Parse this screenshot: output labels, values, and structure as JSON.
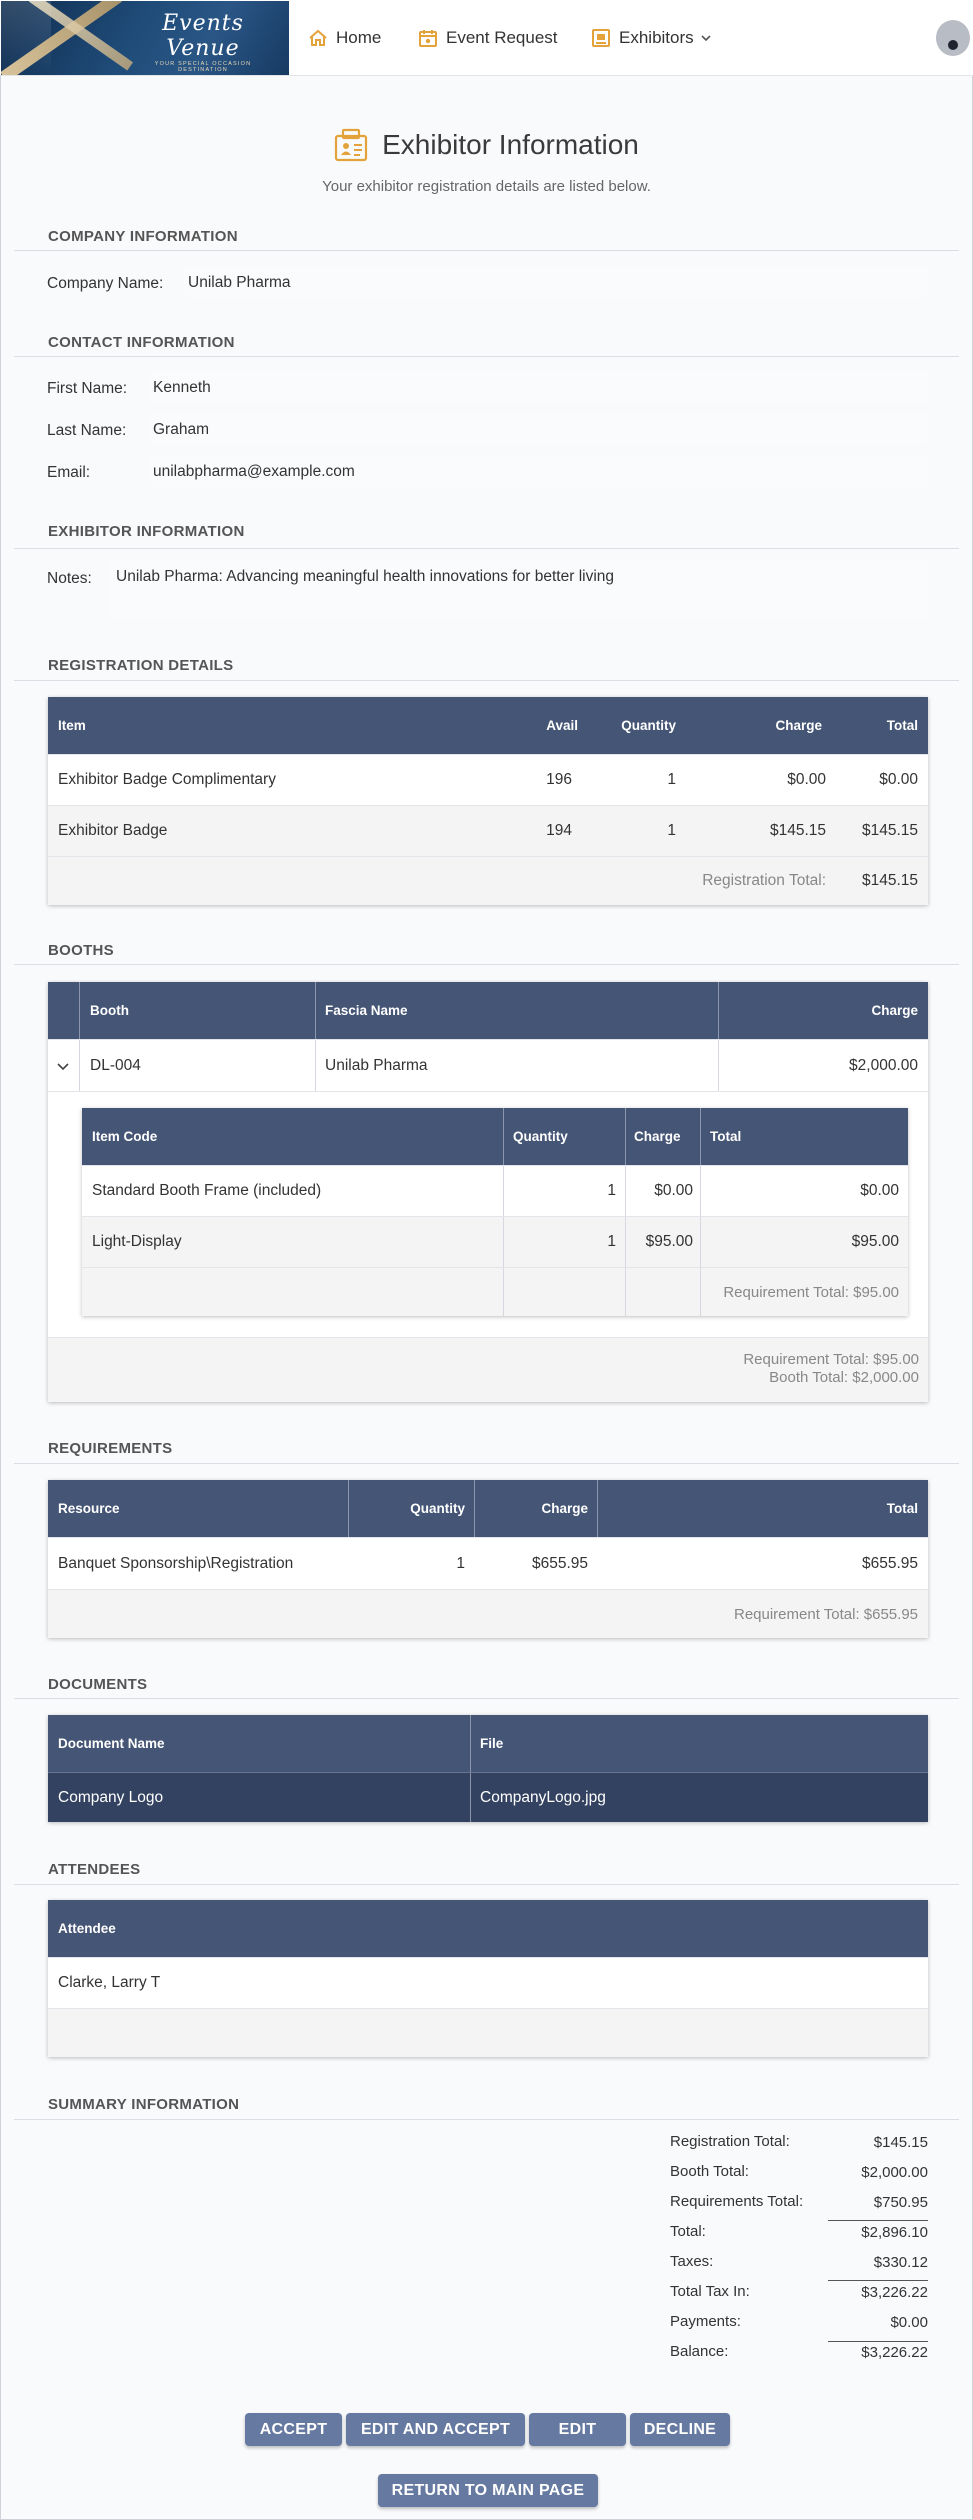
{
  "nav": {
    "logo_text": "Events Venue",
    "logo_tagline": "YOUR SPECIAL OCCASION DESTINATION",
    "items": [
      {
        "label": "Home"
      },
      {
        "label": "Event Request"
      },
      {
        "label": "Exhibitors"
      }
    ]
  },
  "page": {
    "title": "Exhibitor Information",
    "subtitle": "Your exhibitor registration details are listed below."
  },
  "company": {
    "heading": "COMPANY INFORMATION",
    "name_label": "Company Name:",
    "name_value": "Unilab Pharma"
  },
  "contact": {
    "heading": "CONTACT INFORMATION",
    "first_label": "First Name:",
    "first_value": "Kenneth",
    "last_label": "Last Name:",
    "last_value": "Graham",
    "email_label": "Email:",
    "email_value": "unilabpharma@example.com"
  },
  "exhibitor": {
    "heading": "EXHIBITOR INFORMATION",
    "notes_label": "Notes:",
    "notes_value": "Unilab Pharma: Advancing meaningful health innovations for better living"
  },
  "registration": {
    "heading": "REGISTRATION DETAILS",
    "columns": [
      "Item",
      "Avail",
      "Quantity",
      "Charge",
      "Total"
    ],
    "rows": [
      {
        "item": "Exhibitor Badge Complimentary",
        "avail": "196",
        "qty": "1",
        "charge": "$0.00",
        "total": "$0.00"
      },
      {
        "item": "Exhibitor Badge",
        "avail": "194",
        "qty": "1",
        "charge": "$145.15",
        "total": "$145.15"
      }
    ],
    "total_label": "Registration Total:",
    "total_value": "$145.15"
  },
  "booths": {
    "heading": "BOOTHS",
    "columns": [
      "Booth",
      "Fascia Name",
      "Charge"
    ],
    "row": {
      "booth": "DL-004",
      "fascia": "Unilab Pharma",
      "charge": "$2,000.00"
    },
    "sub_columns": [
      "Item Code",
      "Quantity",
      "Charge",
      "Total"
    ],
    "sub_rows": [
      {
        "code": "Standard Booth Frame (included)",
        "qty": "1",
        "charge": "$0.00",
        "total": "$0.00"
      },
      {
        "code": "Light-Display",
        "qty": "1",
        "charge": "$95.00",
        "total": "$95.00"
      }
    ],
    "sub_total": "Requirement Total: $95.00",
    "footer_req": "Requirement Total: $95.00",
    "footer_booth": "Booth Total: $2,000.00"
  },
  "requirements": {
    "heading": "REQUIREMENTS",
    "columns": [
      "Resource",
      "Quantity",
      "Charge",
      "Total"
    ],
    "row": {
      "resource": "Banquet Sponsorship\\Registration",
      "qty": "1",
      "charge": "$655.95",
      "total": "$655.95"
    },
    "footer": "Requirement Total: $655.95"
  },
  "documents": {
    "heading": "DOCUMENTS",
    "columns": [
      "Document Name",
      "File"
    ],
    "row": {
      "name": "Company Logo",
      "file": "CompanyLogo.jpg"
    }
  },
  "attendees": {
    "heading": "ATTENDEES",
    "column": "Attendee",
    "row": "Clarke, Larry T"
  },
  "summary": {
    "heading": "SUMMARY INFORMATION",
    "rows": [
      {
        "label": "Registration Total:",
        "value": "$145.15"
      },
      {
        "label": "Booth Total:",
        "value": "$2,000.00"
      },
      {
        "label": "Requirements Total:",
        "value": "$750.95"
      },
      {
        "label": "Total:",
        "value": "$2,896.10"
      },
      {
        "label": "Taxes:",
        "value": "$330.12"
      },
      {
        "label": "Total Tax In:",
        "value": "$3,226.22"
      },
      {
        "label": "Payments:",
        "value": "$0.00"
      },
      {
        "label": "Balance:",
        "value": "$3,226.22"
      }
    ]
  },
  "actions": {
    "accept": "ACCEPT",
    "edit_accept": "EDIT AND ACCEPT",
    "edit": "EDIT",
    "decline": "DECLINE",
    "return": "RETURN TO MAIN PAGE"
  },
  "colors": {
    "table_header": "#455575",
    "document_row": "#334260",
    "button": "#6579a1",
    "accent_icon": "#e3a23a"
  }
}
